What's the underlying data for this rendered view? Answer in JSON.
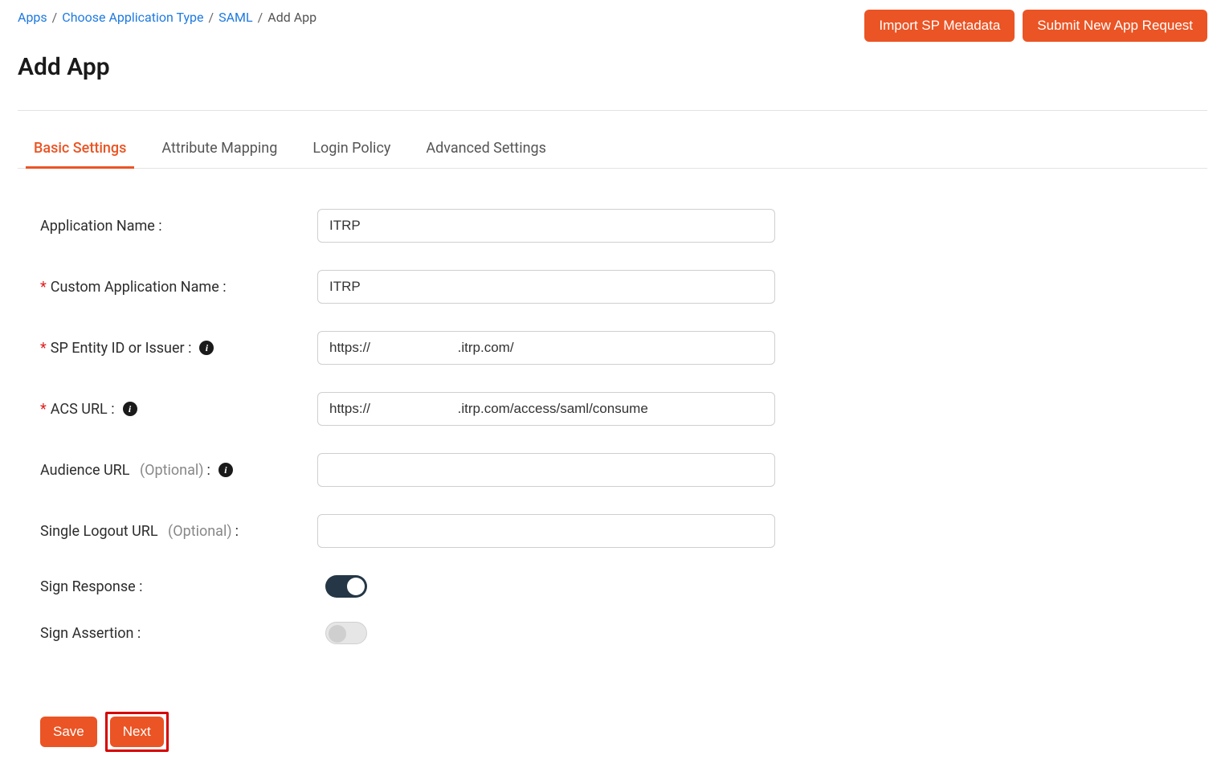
{
  "breadcrumb": {
    "items": [
      "Apps",
      "Choose Application Type",
      "SAML"
    ],
    "current": "Add App"
  },
  "top_actions": {
    "import_sp": "Import SP Metadata",
    "submit_new": "Submit New App Request"
  },
  "page_title": "Add App",
  "tabs": {
    "basic": "Basic Settings",
    "attribute": "Attribute Mapping",
    "login": "Login Policy",
    "advanced": "Advanced Settings"
  },
  "form": {
    "app_name_label": "Application Name :",
    "app_name_value": "ITRP",
    "custom_app_name_label": "Custom Application Name :",
    "custom_app_name_value": "ITRP",
    "sp_entity_label": "SP Entity ID or Issuer :",
    "sp_entity_value": "https://                       .itrp.com/",
    "acs_url_label": "ACS URL :",
    "acs_url_value": "https://                       .itrp.com/access/saml/consume",
    "audience_label": "Audience URL",
    "audience_optional": "(Optional)",
    "audience_colon": " :",
    "audience_value": "",
    "slo_label": "Single Logout URL",
    "slo_optional": "(Optional)",
    "slo_colon": " :",
    "slo_value": "",
    "sign_response_label": "Sign Response :",
    "sign_assertion_label": "Sign Assertion :"
  },
  "bottom": {
    "save": "Save",
    "next": "Next"
  },
  "info_glyph": "i"
}
